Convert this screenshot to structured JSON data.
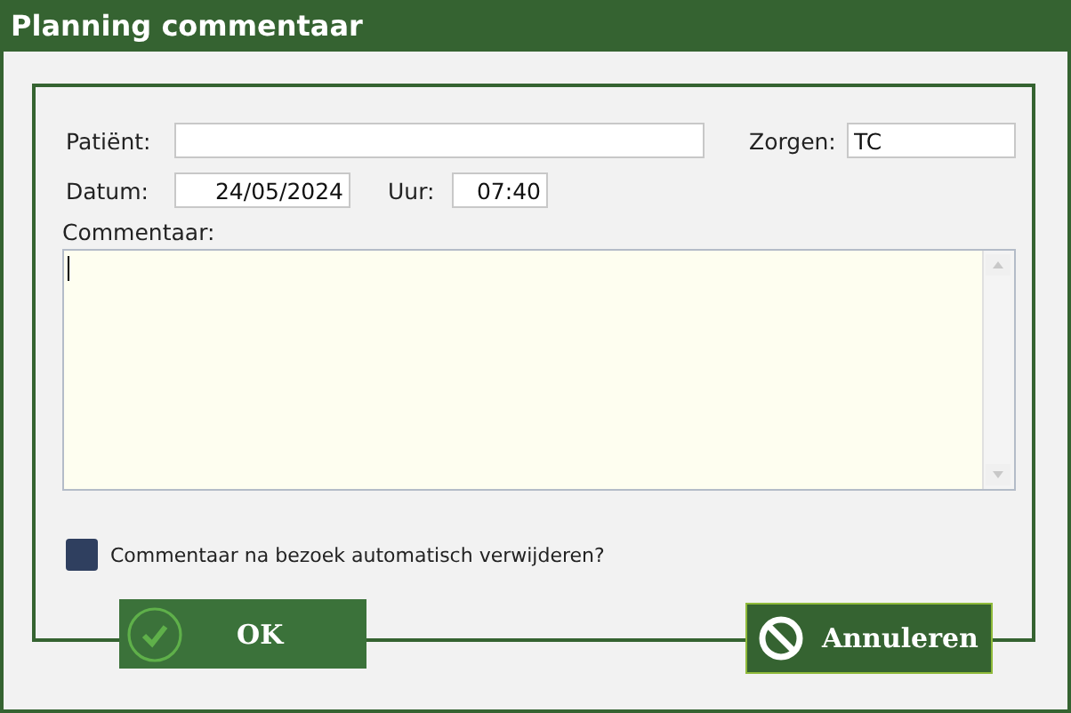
{
  "window": {
    "title": "Planning commentaar"
  },
  "fields": {
    "patient": {
      "label": "Patiënt:"
    },
    "zorgen": {
      "label": "Zorgen:",
      "value": "TC"
    },
    "datum": {
      "label": "Datum:",
      "value": "24/05/2024"
    },
    "uur": {
      "label": "Uur:",
      "value": "07:40"
    }
  },
  "comment": {
    "label": "Commentaar:"
  },
  "auto_delete": {
    "label": "Commentaar na bezoek automatisch verwijderen?",
    "checked": false
  },
  "buttons": [
    {
      "label": "OK",
      "kind": "ok"
    },
    {
      "label": "Annuleren",
      "kind": "cancel"
    }
  ]
}
